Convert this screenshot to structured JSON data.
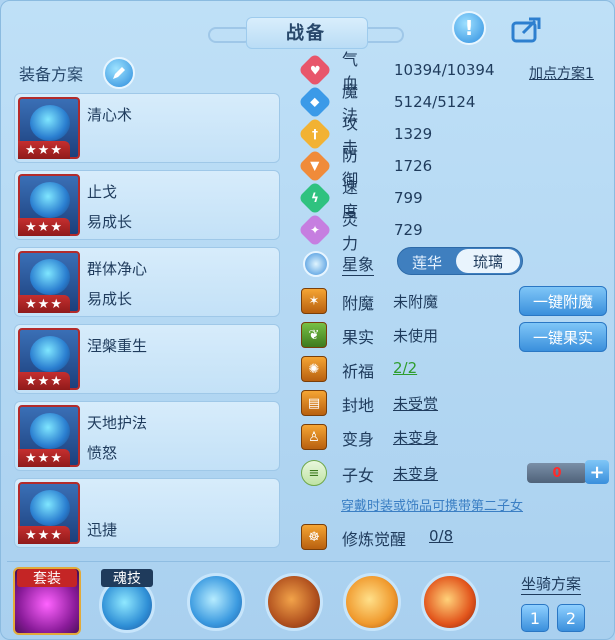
{
  "header": {
    "title": "战备"
  },
  "left": {
    "plan_label": "装备方案",
    "cards": [
      {
        "name1": "清心术",
        "name2": "",
        "stars": "★★★"
      },
      {
        "name1": "止戈",
        "name2": "易成长",
        "stars": "★★★"
      },
      {
        "name1": "群体净心",
        "name2": "易成长",
        "stars": "★★★"
      },
      {
        "name1": "涅槃重生",
        "name2": "",
        "stars": "★★★"
      },
      {
        "name1": "天地护法",
        "name2": "愤怒",
        "stars": "★★★"
      },
      {
        "name1": "",
        "name2": "迅捷",
        "stars": "★★★"
      }
    ]
  },
  "stats": {
    "point_plan": "加点方案1",
    "items": [
      {
        "label": "气血",
        "value": "10394/10394",
        "color": "#e8566b"
      },
      {
        "label": "魔法",
        "value": "5124/5124",
        "color": "#3b9ae8"
      },
      {
        "label": "攻击",
        "value": "1329",
        "color": "#f2b233"
      },
      {
        "label": "防御",
        "value": "1726",
        "color": "#f08b3a"
      },
      {
        "label": "速度",
        "value": "799",
        "color": "#2fc27f"
      },
      {
        "label": "灵力",
        "value": "729",
        "color": "#c67ee0"
      }
    ],
    "star_label": "星象",
    "star_options": [
      "莲华",
      "琉璃"
    ]
  },
  "features": {
    "items": [
      {
        "label": "附魔",
        "value": "未附魔",
        "style": "plain"
      },
      {
        "label": "果实",
        "value": "未使用",
        "style": "plain"
      },
      {
        "label": "祈福",
        "value": "2/2",
        "style": "green"
      },
      {
        "label": "封地",
        "value": "未受赏",
        "style": "u"
      },
      {
        "label": "变身",
        "value": "未变身",
        "style": "u"
      },
      {
        "label": "子女",
        "value": "未变身",
        "style": "u"
      },
      {
        "label": "修炼觉醒",
        "value": "0/8",
        "style": "u"
      }
    ],
    "enchant_button": "一键附魔",
    "fruit_button": "一键果实",
    "child_hint": "穿戴时装或饰品可携带第二子女",
    "child_count": "0",
    "plus": "+"
  },
  "bottom": {
    "set_label": "套装",
    "soul_label": "魂技",
    "mount_label": "坐骑方案",
    "mount_options": [
      "1",
      "2"
    ]
  }
}
